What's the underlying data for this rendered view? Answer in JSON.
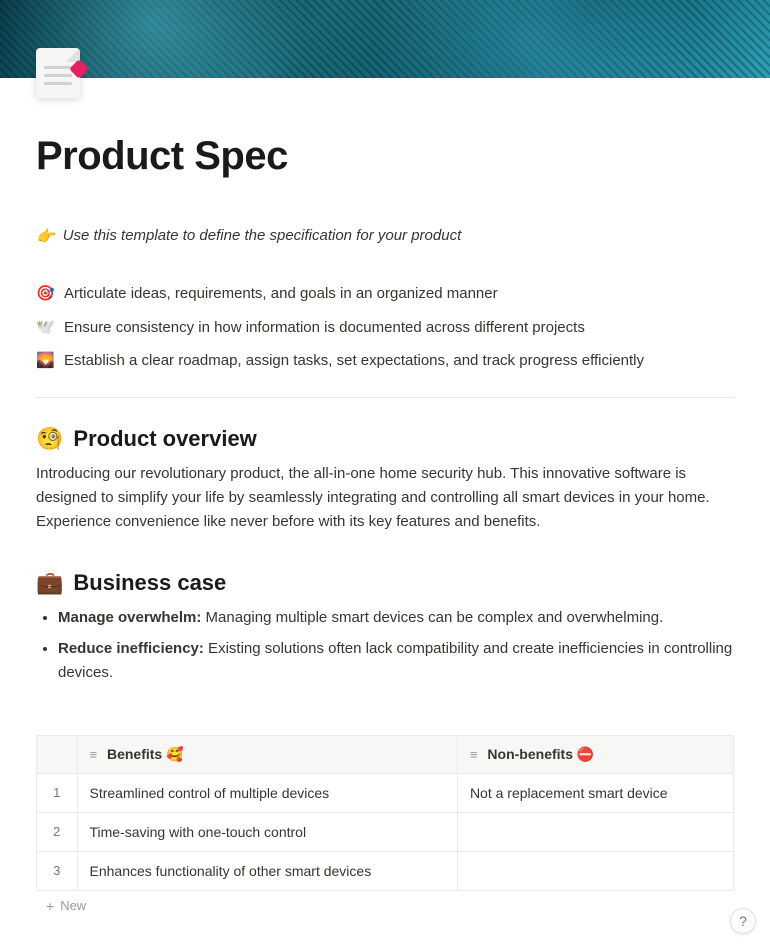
{
  "page": {
    "title": "Product Spec"
  },
  "callout": {
    "icon": "👉",
    "text": "Use this template to define the specification for your product"
  },
  "goals": [
    {
      "icon": "🎯",
      "text": "Articulate ideas, requirements, and goals in an organized manner"
    },
    {
      "icon": "🕊️",
      "text": "Ensure consistency in how information is documented across different projects"
    },
    {
      "icon": "🌄",
      "text": "Establish a clear roadmap, assign tasks, set expectations, and track progress efficiently"
    }
  ],
  "overview": {
    "icon": "🧐",
    "heading": "Product overview",
    "body": "Introducing our revolutionary product, the all-in-one home security hub. This innovative software is designed to simplify your life by seamlessly integrating and controlling all smart devices in your home. Experience convenience like never before with its key features and benefits."
  },
  "business_case": {
    "icon": "💼",
    "heading": "Business case",
    "items": [
      {
        "bold": "Manage overwhelm:",
        "text": " Managing multiple smart devices can be complex and overwhelming."
      },
      {
        "bold": "Reduce inefficiency:",
        "text": " Existing solutions often lack compatibility and create inefficiencies in controlling devices."
      }
    ]
  },
  "table": {
    "columns": {
      "benefits": {
        "label": "Benefits",
        "emoji": "🥰"
      },
      "non_benefits": {
        "label": "Non-benefits",
        "emoji": "⛔"
      }
    },
    "rows": [
      {
        "n": "1",
        "benefit": "Streamlined control of multiple devices",
        "non_benefit": "Not a replacement smart device"
      },
      {
        "n": "2",
        "benefit": "Time-saving with one-touch control",
        "non_benefit": ""
      },
      {
        "n": "3",
        "benefit": "Enhances functionality of other smart devices",
        "non_benefit": ""
      }
    ],
    "new_label": "New"
  },
  "help": "?"
}
